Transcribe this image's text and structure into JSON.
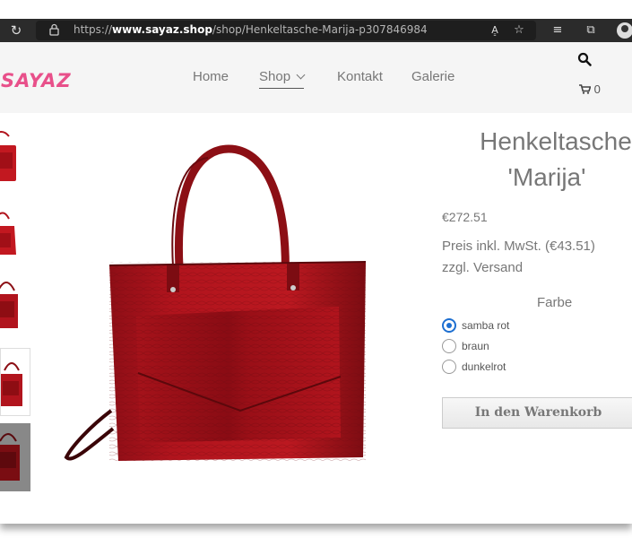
{
  "browser": {
    "url_prefix": "https://",
    "url_domain": "www.sayaz.shop",
    "url_path": "/shop/Henkeltasche-Marija-p307846984"
  },
  "header": {
    "logo_text": "SAYAZ",
    "nav": [
      {
        "label": "Home"
      },
      {
        "label": "Shop"
      },
      {
        "label": "Kontakt"
      },
      {
        "label": "Galerie"
      }
    ],
    "cart_count": "0"
  },
  "product": {
    "title_line1": "Henkeltasche",
    "title_line2": "'Marija'",
    "price": "€272.51",
    "tax_line1": "Preis inkl. MwSt. (€43.51)",
    "tax_line2": "zzgl. Versand",
    "option_label": "Farbe",
    "options": [
      {
        "label": "samba rot",
        "selected": true
      },
      {
        "label": "braun",
        "selected": false
      },
      {
        "label": "dunkelrot",
        "selected": false
      }
    ],
    "add_to_cart_label": "In den Warenkorb",
    "bag_color": "#b1141d"
  }
}
